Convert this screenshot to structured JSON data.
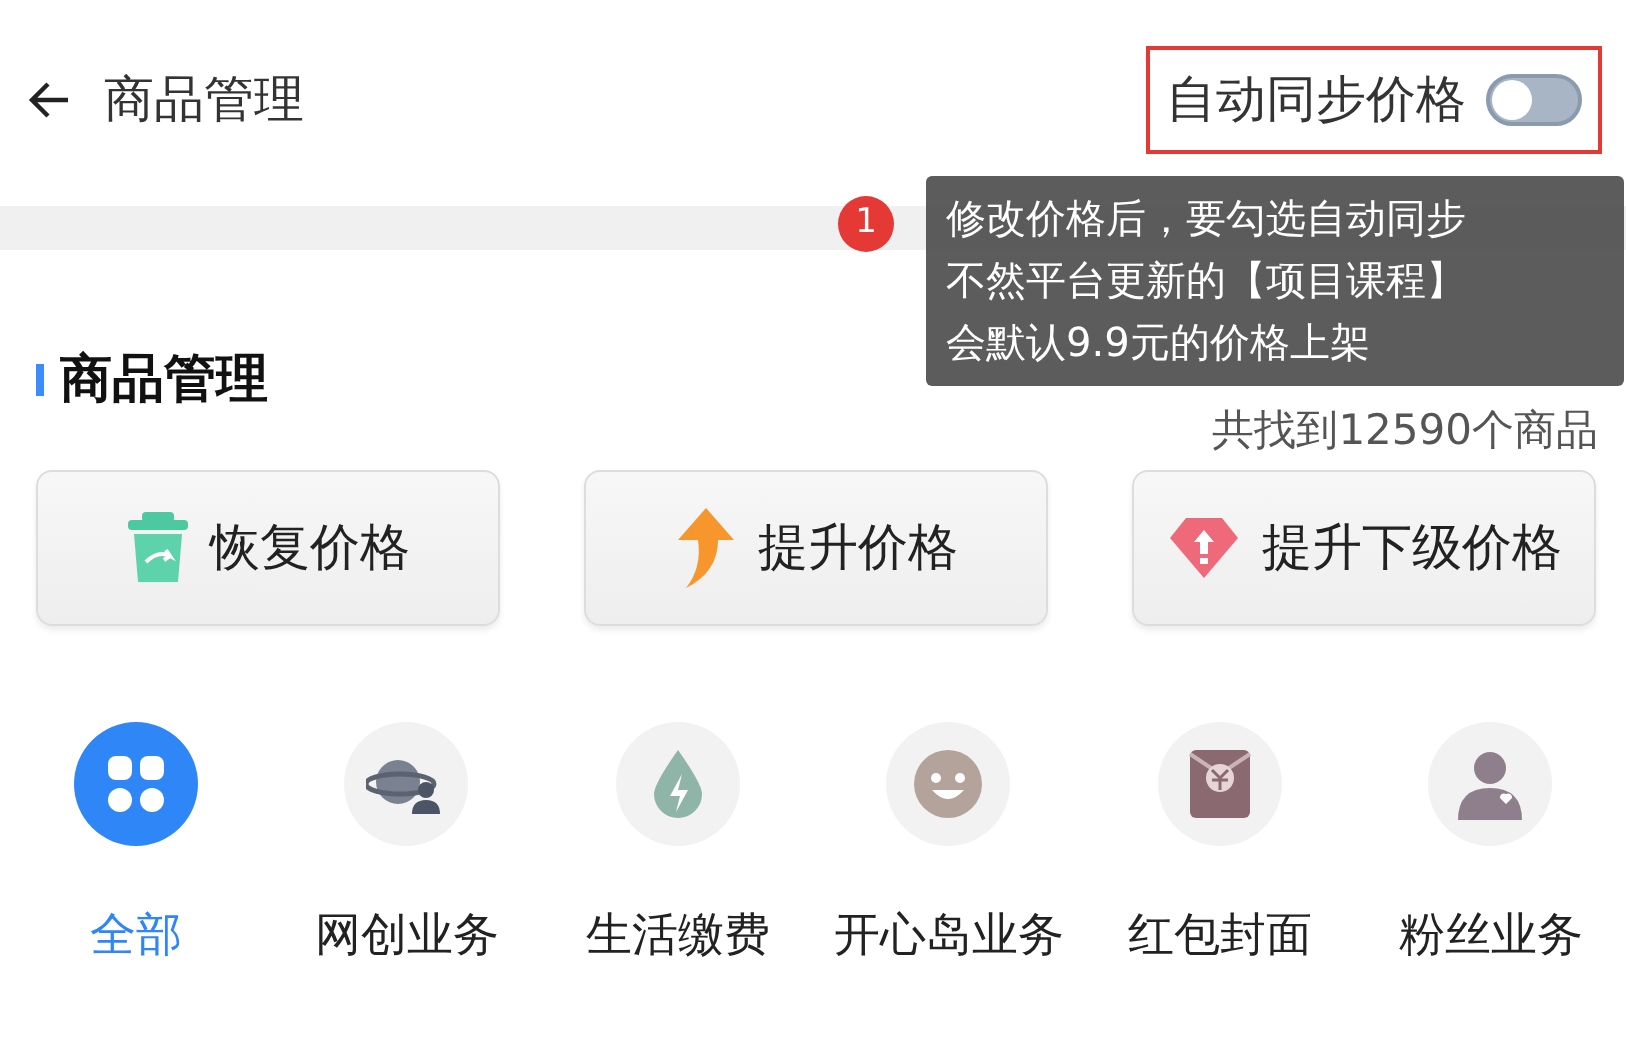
{
  "header": {
    "title": "商品管理",
    "auto_sync": {
      "label": "自动同步价格",
      "on": false
    }
  },
  "tooltip": {
    "badge": "1",
    "lines": [
      "修改价格后，要勾选自动同步",
      "不然平台更新的【项目课程】",
      "会默认9.9元的价格上架"
    ]
  },
  "section": {
    "title": "商品管理",
    "count": "共找到12590个商品"
  },
  "actions": [
    {
      "kind": "trash",
      "label": "恢复价格"
    },
    {
      "kind": "up",
      "label": "提升价格"
    },
    {
      "kind": "diamond",
      "label": "提升下级价格"
    }
  ],
  "categories": [
    {
      "kind": "all",
      "label": "全部",
      "selected": true
    },
    {
      "kind": "planet",
      "label": "网创业务",
      "selected": false
    },
    {
      "kind": "drop",
      "label": "生活缴费",
      "selected": false
    },
    {
      "kind": "smile",
      "label": "开心岛业务",
      "selected": false
    },
    {
      "kind": "envelope",
      "label": "红包封面",
      "selected": false
    },
    {
      "kind": "person",
      "label": "粉丝业务",
      "selected": false
    }
  ]
}
